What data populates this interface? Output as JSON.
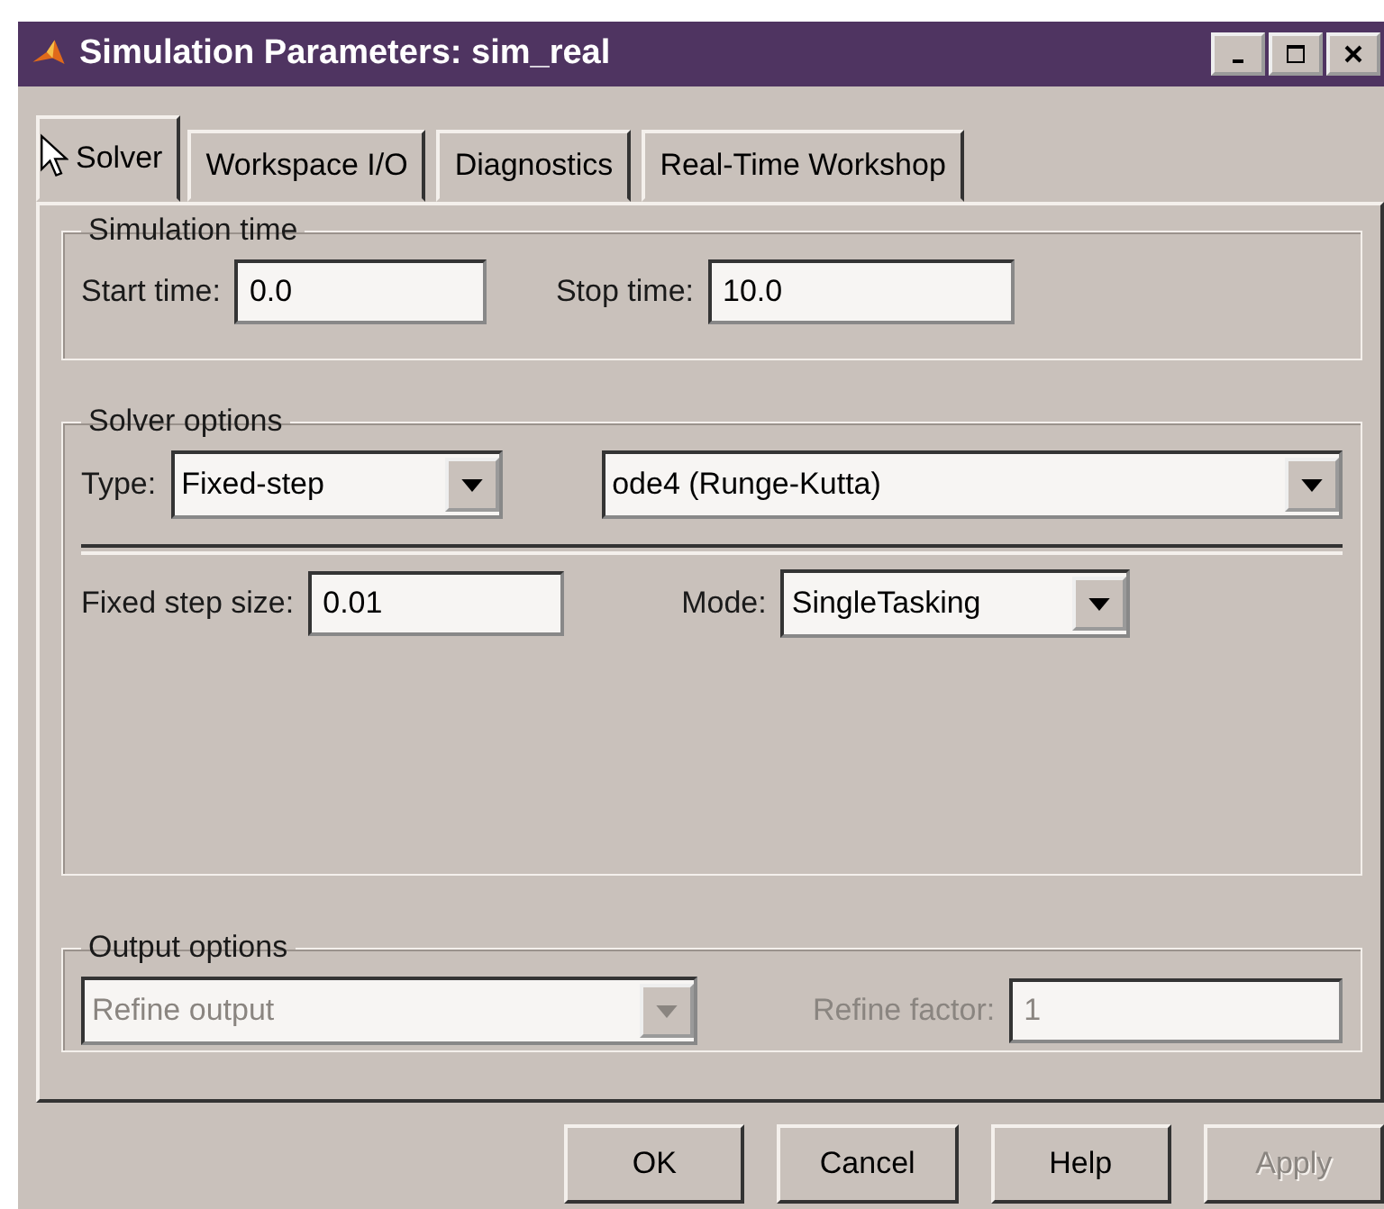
{
  "window": {
    "title": "Simulation Parameters: sim_real"
  },
  "tabs": [
    {
      "label": "Solver",
      "selected": true
    },
    {
      "label": "Workspace I/O",
      "selected": false
    },
    {
      "label": "Diagnostics",
      "selected": false
    },
    {
      "label": "Real-Time Workshop",
      "selected": false
    }
  ],
  "simulation_time": {
    "title": "Simulation time",
    "start_label": "Start time:",
    "start_value": "0.0",
    "stop_label": "Stop time:",
    "stop_value": "10.0"
  },
  "solver_options": {
    "title": "Solver options",
    "type_label": "Type:",
    "type_value": "Fixed-step",
    "solver_value": "ode4 (Runge-Kutta)",
    "step_label": "Fixed step size:",
    "step_value": "0.01",
    "mode_label": "Mode:",
    "mode_value": "SingleTasking"
  },
  "output_options": {
    "title": "Output options",
    "output_value": "Refine output",
    "output_disabled": true,
    "factor_label": "Refine factor:",
    "factor_value": "1",
    "factor_disabled": true
  },
  "buttons": [
    {
      "label": "OK",
      "disabled": false
    },
    {
      "label": "Cancel",
      "disabled": false
    },
    {
      "label": "Help",
      "disabled": false
    },
    {
      "label": "Apply",
      "disabled": true
    }
  ]
}
